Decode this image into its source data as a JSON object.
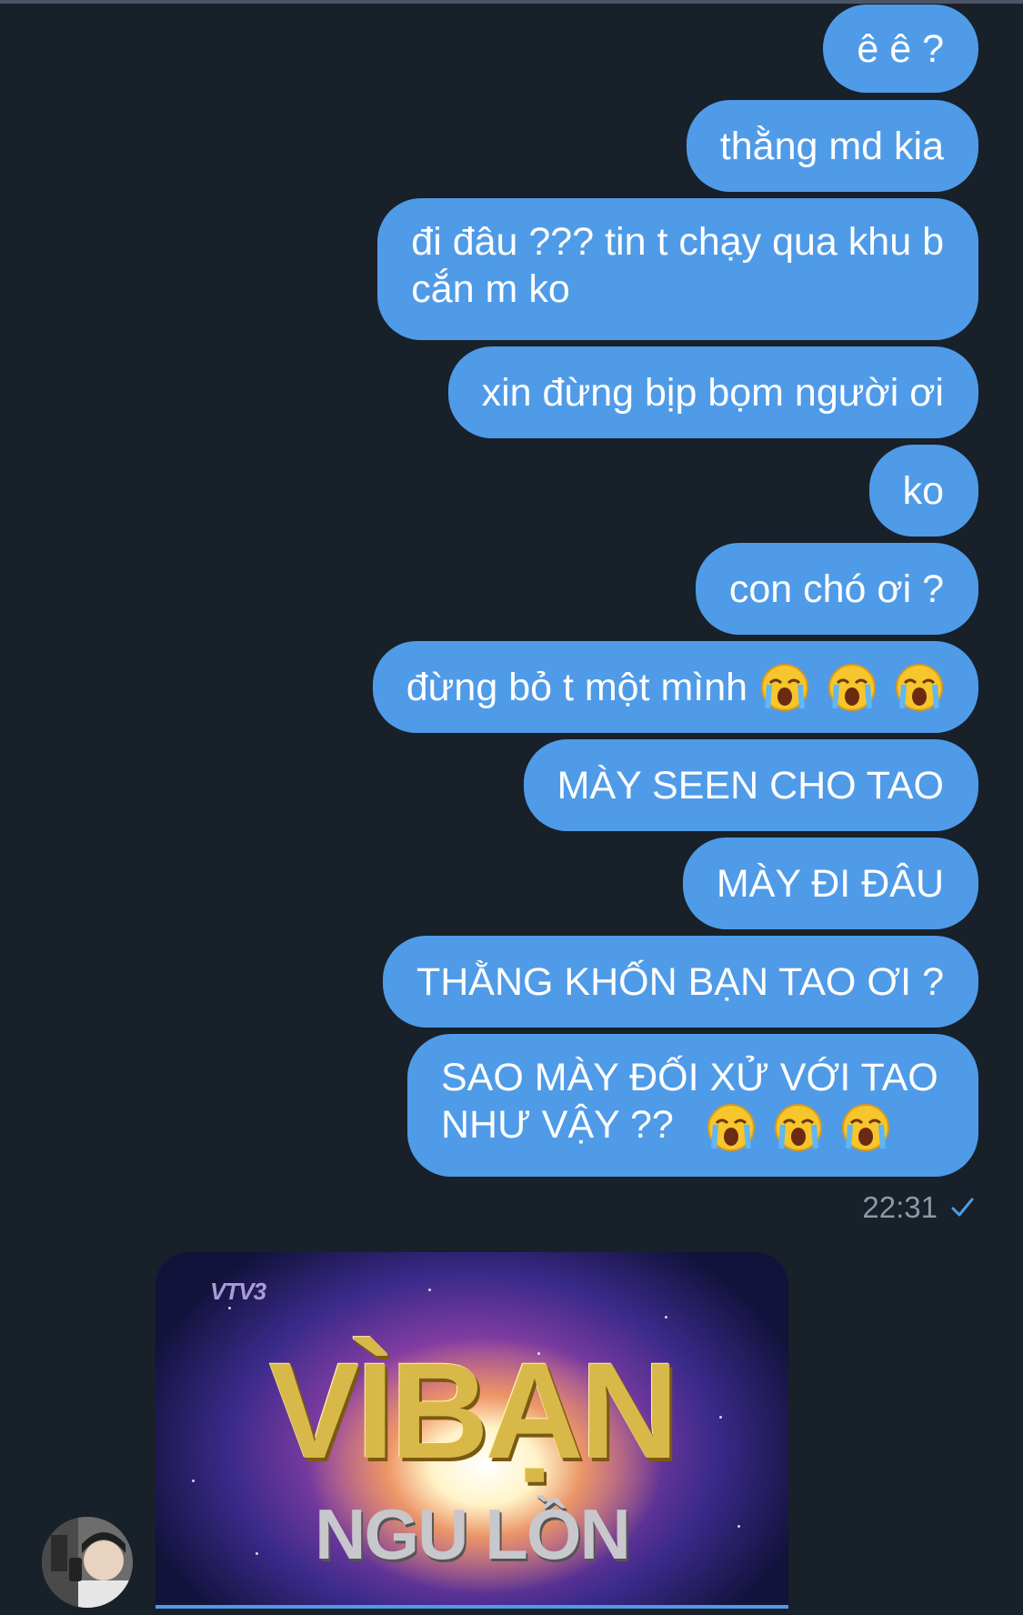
{
  "messages": [
    {
      "text": "ê ê ?"
    },
    {
      "text": "thằng md kia"
    },
    {
      "line1": "đi đâu ??? tin t chạy qua khu b",
      "line2": "cắn m ko"
    },
    {
      "text": "xin đừng bịp bọm người ơi"
    },
    {
      "text": "ko"
    },
    {
      "text": "con chó ơi ?"
    },
    {
      "text": "đừng bỏ t một mình",
      "emoji": "loudly-crying-face",
      "emoji_count": 3
    },
    {
      "text": "MÀY SEEN CHO TAO"
    },
    {
      "text": "MÀY ĐI ĐÂU"
    },
    {
      "text": "THẰNG KHỐN BẠN TAO ƠI ?"
    },
    {
      "line1": "SAO MÀY ĐỐI XỬ VỚI TAO",
      "line2": "NHƯ VẬY ??",
      "emoji": "loudly-crying-face",
      "emoji_count": 3
    }
  ],
  "status": {
    "time": "22:31",
    "icon": "check-icon"
  },
  "image_message": {
    "channel_logo": "VTV3",
    "title": "VÌBẠN",
    "subtitle": "NGU LỒN"
  },
  "colors": {
    "background": "#18202a",
    "bubble": "#4f9be8",
    "timestamp": "#8e99a6"
  }
}
